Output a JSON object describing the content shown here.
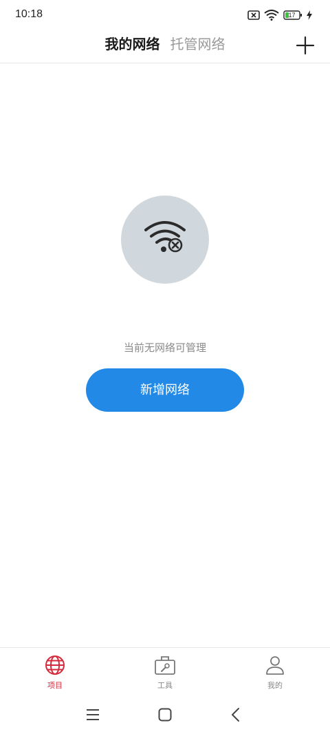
{
  "status": {
    "time": "10:18",
    "battery": "17"
  },
  "header": {
    "tabs": [
      {
        "label": "我的网络",
        "active": true
      },
      {
        "label": "托管网络",
        "active": false
      }
    ],
    "add_icon": "plus-icon"
  },
  "empty_state": {
    "icon": "wifi-off-icon",
    "message": "当前无网络可管理",
    "button_label": "新增网络"
  },
  "bottom_nav": {
    "items": [
      {
        "label": "项目",
        "icon": "globe-icon",
        "active": true
      },
      {
        "label": "工具",
        "icon": "toolbox-icon",
        "active": false
      },
      {
        "label": "我的",
        "icon": "person-icon",
        "active": false
      }
    ]
  },
  "system_nav": {
    "icons": [
      "menu-icon",
      "home-icon",
      "back-icon"
    ]
  },
  "colors": {
    "accent": "#2289e6",
    "nav_active": "#d42a3b",
    "illustration_bg": "#d1d8dd"
  }
}
